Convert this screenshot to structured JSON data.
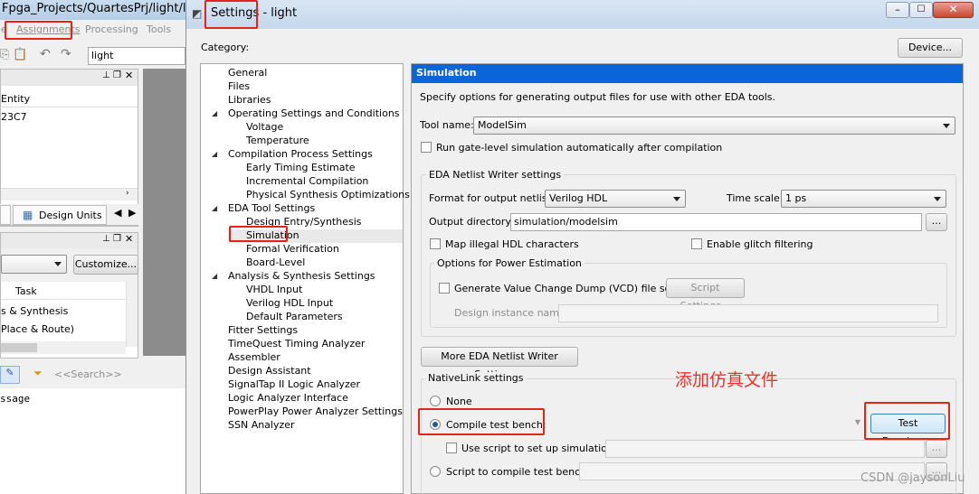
{
  "bg_window": {
    "title": "Fpga_Projects/QuartesPrj/light/ligh",
    "menu": [
      "e",
      "Assignments",
      "Processing",
      "Tools"
    ],
    "toolbar_combo": "light",
    "hierarchy": {
      "col_header": "Entity",
      "row": "23C7"
    },
    "design_units_tab": "Design Units",
    "customize_button": "Customize...",
    "task_header": "Task",
    "task_rows": [
      "s & Synthesis",
      "Place & Route)"
    ],
    "search_placeholder": "<<Search>>",
    "message_label": "ssage"
  },
  "dialog": {
    "title": "Settings - light",
    "category_label": "Category:",
    "device_button": "Device...",
    "categories": [
      {
        "label": "General",
        "level": 1
      },
      {
        "label": "Files",
        "level": 1
      },
      {
        "label": "Libraries",
        "level": 1
      },
      {
        "label": "Operating Settings and Conditions",
        "level": 1,
        "expanded": true
      },
      {
        "label": "Voltage",
        "level": 2
      },
      {
        "label": "Temperature",
        "level": 2
      },
      {
        "label": "Compilation Process Settings",
        "level": 1,
        "expanded": true
      },
      {
        "label": "Early Timing Estimate",
        "level": 2
      },
      {
        "label": "Incremental Compilation",
        "level": 2
      },
      {
        "label": "Physical Synthesis Optimizations",
        "level": 2
      },
      {
        "label": "EDA Tool Settings",
        "level": 1,
        "expanded": true
      },
      {
        "label": "Design Entry/Synthesis",
        "level": 2
      },
      {
        "label": "Simulation",
        "level": 2,
        "selected": true
      },
      {
        "label": "Formal Verification",
        "level": 2
      },
      {
        "label": "Board-Level",
        "level": 2
      },
      {
        "label": "Analysis & Synthesis Settings",
        "level": 1,
        "expanded": true
      },
      {
        "label": "VHDL Input",
        "level": 2
      },
      {
        "label": "Verilog HDL Input",
        "level": 2
      },
      {
        "label": "Default Parameters",
        "level": 2
      },
      {
        "label": "Fitter Settings",
        "level": 1
      },
      {
        "label": "TimeQuest Timing Analyzer",
        "level": 1
      },
      {
        "label": "Assembler",
        "level": 1
      },
      {
        "label": "Design Assistant",
        "level": 1
      },
      {
        "label": "SignalTap II Logic Analyzer",
        "level": 1
      },
      {
        "label": "Logic Analyzer Interface",
        "level": 1
      },
      {
        "label": "PowerPlay Power Analyzer Settings",
        "level": 1
      },
      {
        "label": "SSN Analyzer",
        "level": 1
      }
    ],
    "panel": {
      "header": "Simulation",
      "description": "Specify options for generating output files for use with other EDA tools.",
      "tool_name_label": "Tool name:",
      "tool_name_value": "ModelSim",
      "run_gate_level": "Run gate-level simulation automatically after compilation",
      "eda_group_title": "EDA Netlist Writer settings",
      "format_label": "Format for output netlist:",
      "format_value": "Verilog HDL",
      "timescale_label": "Time scale:",
      "timescale_value": "1 ps",
      "output_dir_label": "Output directory:",
      "output_dir_value": "simulation/modelsim",
      "browse_label": "...",
      "map_illegal": "Map illegal HDL characters",
      "glitch_filter": "Enable glitch filtering",
      "power_group_title": "Options for Power Estimation",
      "gen_vcd": "Generate Value Change Dump (VCD) file script",
      "script_settings_button": "Script Settings...",
      "design_instance_label": "Design instance name:",
      "more_settings_button": "More EDA Netlist Writer Settings...",
      "nativelink_title": "NativeLink settings",
      "radio_none": "None",
      "radio_compile_tb": "Compile test bench:",
      "test_benches_button": "Test Benches...",
      "use_script": "Use script to set up simulation:",
      "script_compile_tb": "Script to compile test bench:"
    }
  },
  "annotation": "添加仿真文件",
  "watermark": "CSDN @jaysonLiu",
  "colors": {
    "accent": "#0a66d8",
    "highlight": "#e0261b",
    "annotation": "#e8332a"
  }
}
